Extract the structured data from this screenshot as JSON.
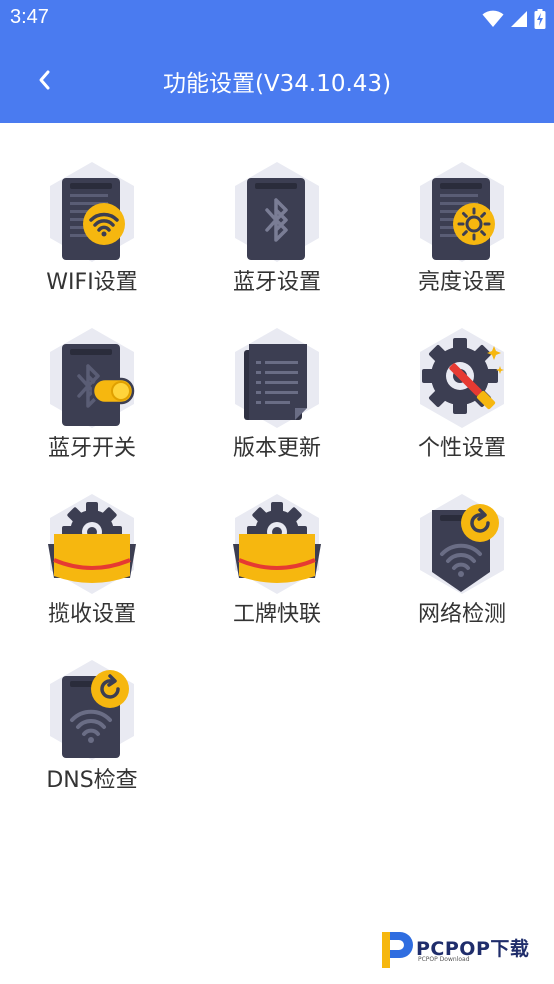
{
  "status_bar": {
    "time": "3:47",
    "icons": [
      "wifi-icon",
      "signal-icon",
      "battery-charging-icon"
    ]
  },
  "header": {
    "back_icon": "chevron-left-icon",
    "title": "功能设置(V34.10.43)"
  },
  "items": [
    {
      "label": "WIFI设置",
      "icon": "wifi-settings-icon"
    },
    {
      "label": "蓝牙设置",
      "icon": "bluetooth-settings-icon"
    },
    {
      "label": "亮度设置",
      "icon": "brightness-settings-icon"
    },
    {
      "label": "蓝牙开关",
      "icon": "bluetooth-toggle-icon"
    },
    {
      "label": "版本更新",
      "icon": "version-update-icon"
    },
    {
      "label": "个性设置",
      "icon": "personalization-icon"
    },
    {
      "label": "揽收设置",
      "icon": "pickup-settings-icon"
    },
    {
      "label": "工牌快联",
      "icon": "badge-quick-connect-icon"
    },
    {
      "label": "网络检测",
      "icon": "network-check-icon"
    },
    {
      "label": "DNS检查",
      "icon": "dns-check-icon"
    }
  ],
  "watermark": {
    "brand": "PCPOP下载",
    "sub": "PCPOP Download"
  },
  "colors": {
    "header_bg": "#4a7bf0",
    "hexagon_bg": "#e9eaf2",
    "device_dark": "#3c3e52",
    "accent_yellow": "#f6b70f",
    "accent_red": "#e63a32",
    "label_text": "#333333"
  }
}
